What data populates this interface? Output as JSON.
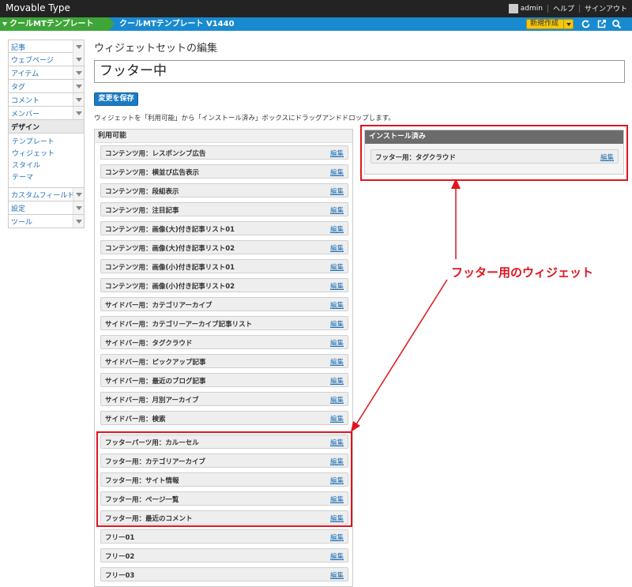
{
  "app": {
    "title": "Movable Type",
    "user": "admin",
    "help": "ヘルプ",
    "signout": "サインアウト"
  },
  "blogbar": {
    "site": "クールMTテンプレート V14",
    "blog": "クールMTテンプレート V1440",
    "new_button": "新規作成",
    "icons": [
      "refresh-icon",
      "external-link-icon",
      "search-icon"
    ]
  },
  "sidebar": {
    "items": [
      {
        "label": "記事"
      },
      {
        "label": "ウェブページ"
      },
      {
        "label": "アイテム"
      },
      {
        "label": "タグ"
      },
      {
        "label": "コメント"
      },
      {
        "label": "メンバー"
      },
      {
        "label": "デザイン"
      }
    ],
    "sub_items": [
      "テンプレート",
      "ウィジェット",
      "スタイル",
      "テーマ"
    ],
    "items_after": [
      {
        "label": "カスタムフィールド"
      },
      {
        "label": "設定"
      },
      {
        "label": "ツール"
      }
    ]
  },
  "main": {
    "page_title": "ウィジェットセットの編集",
    "set_name": "フッター中",
    "save_button": "変更を保存",
    "instructions": "ウィジェットを「利用可能」から「インストール済み」ボックスにドラッグアンドドロップします。"
  },
  "available": {
    "heading": "利用可能",
    "edit_label": "編集",
    "widgets": [
      "コンテンツ用：レスポンシブ広告",
      "コンテンツ用：横並び広告表示",
      "コンテンツ用：段組表示",
      "コンテンツ用：注目記事",
      "コンテンツ用：画像(大)付き記事リスト01",
      "コンテンツ用：画像(大)付き記事リスト02",
      "コンテンツ用：画像(小)付き記事リスト01",
      "コンテンツ用：画像(小)付き記事リスト02",
      "サイドバー用：カテゴリアーカイブ",
      "サイドバー用：カテゴリーアーカイブ記事リスト",
      "サイドバー用：タグクラウド",
      "サイドバー用：ピックアップ記事",
      "サイドバー用：最近のブログ記事",
      "サイドバー用：月別アーカイブ",
      "サイドバー用：検索",
      "フッターパーツ用：カルーセル",
      "フッター用：カテゴリアーカイブ",
      "フッター用：サイト情報",
      "フッター用：ページ一覧",
      "フッター用：最近のコメント",
      "フリー01",
      "フリー02",
      "フリー03"
    ]
  },
  "installed": {
    "heading": "インストール済み",
    "edit_label": "編集",
    "widgets": [
      "フッター用：タグクラウド"
    ]
  },
  "annotation": {
    "label": "フッター用のウィジェット",
    "color": "#e0141e"
  }
}
